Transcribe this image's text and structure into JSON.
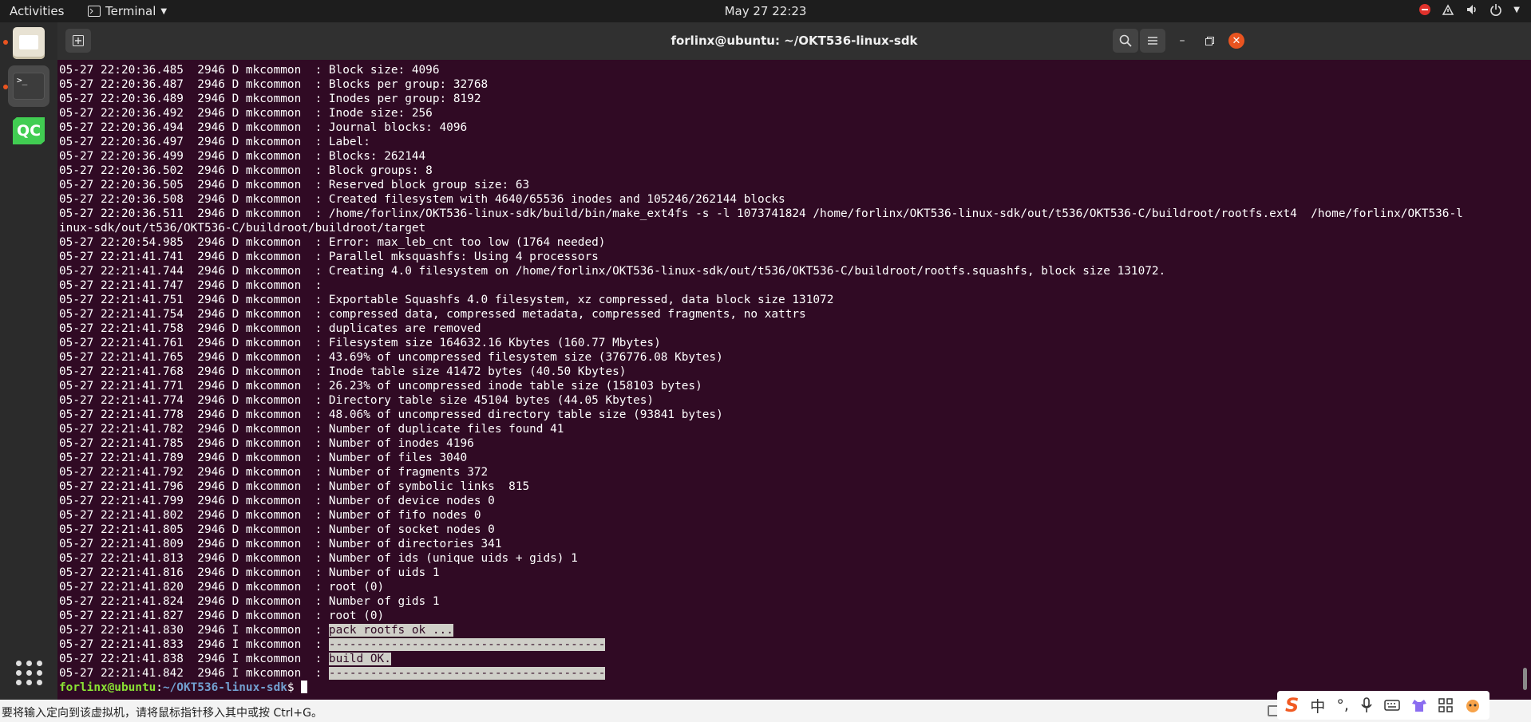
{
  "topbar": {
    "activities": "Activities",
    "app_menu": "Terminal",
    "clock": "May 27  22:23"
  },
  "window": {
    "title": "forlinx@ubuntu: ~/OKT536-linux-sdk"
  },
  "terminal": {
    "lines": [
      {
        "text": "05-27 22:20:36.485  2946 D mkcommon  : Block size: 4096"
      },
      {
        "text": "05-27 22:20:36.487  2946 D mkcommon  : Blocks per group: 32768"
      },
      {
        "text": "05-27 22:20:36.489  2946 D mkcommon  : Inodes per group: 8192"
      },
      {
        "text": "05-27 22:20:36.492  2946 D mkcommon  : Inode size: 256"
      },
      {
        "text": "05-27 22:20:36.494  2946 D mkcommon  : Journal blocks: 4096"
      },
      {
        "text": "05-27 22:20:36.497  2946 D mkcommon  : Label:"
      },
      {
        "text": "05-27 22:20:36.499  2946 D mkcommon  : Blocks: 262144"
      },
      {
        "text": "05-27 22:20:36.502  2946 D mkcommon  : Block groups: 8"
      },
      {
        "text": "05-27 22:20:36.505  2946 D mkcommon  : Reserved block group size: 63"
      },
      {
        "text": "05-27 22:20:36.508  2946 D mkcommon  : Created filesystem with 4640/65536 inodes and 105246/262144 blocks"
      },
      {
        "text": "05-27 22:20:36.511  2946 D mkcommon  : /home/forlinx/OKT536-linux-sdk/build/bin/make_ext4fs -s -l 1073741824 /home/forlinx/OKT536-linux-sdk/out/t536/OKT536-C/buildroot/rootfs.ext4  /home/forlinx/OKT536-l"
      },
      {
        "text": "inux-sdk/out/t536/OKT536-C/buildroot/buildroot/target"
      },
      {
        "text": "05-27 22:20:54.985  2946 D mkcommon  : Error: max_leb_cnt too low (1764 needed)"
      },
      {
        "text": "05-27 22:21:41.741  2946 D mkcommon  : Parallel mksquashfs: Using 4 processors"
      },
      {
        "text": "05-27 22:21:41.744  2946 D mkcommon  : Creating 4.0 filesystem on /home/forlinx/OKT536-linux-sdk/out/t536/OKT536-C/buildroot/rootfs.squashfs, block size 131072."
      },
      {
        "text": "05-27 22:21:41.747  2946 D mkcommon  :"
      },
      {
        "text": "05-27 22:21:41.751  2946 D mkcommon  : Exportable Squashfs 4.0 filesystem, xz compressed, data block size 131072"
      },
      {
        "text": "05-27 22:21:41.754  2946 D mkcommon  : compressed data, compressed metadata, compressed fragments, no xattrs"
      },
      {
        "text": "05-27 22:21:41.758  2946 D mkcommon  : duplicates are removed"
      },
      {
        "text": "05-27 22:21:41.761  2946 D mkcommon  : Filesystem size 164632.16 Kbytes (160.77 Mbytes)"
      },
      {
        "text": "05-27 22:21:41.765  2946 D mkcommon  : 43.69% of uncompressed filesystem size (376776.08 Kbytes)"
      },
      {
        "text": "05-27 22:21:41.768  2946 D mkcommon  : Inode table size 41472 bytes (40.50 Kbytes)"
      },
      {
        "text": "05-27 22:21:41.771  2946 D mkcommon  : 26.23% of uncompressed inode table size (158103 bytes)"
      },
      {
        "text": "05-27 22:21:41.774  2946 D mkcommon  : Directory table size 45104 bytes (44.05 Kbytes)"
      },
      {
        "text": "05-27 22:21:41.778  2946 D mkcommon  : 48.06% of uncompressed directory table size (93841 bytes)"
      },
      {
        "text": "05-27 22:21:41.782  2946 D mkcommon  : Number of duplicate files found 41"
      },
      {
        "text": "05-27 22:21:41.785  2946 D mkcommon  : Number of inodes 4196"
      },
      {
        "text": "05-27 22:21:41.789  2946 D mkcommon  : Number of files 3040"
      },
      {
        "text": "05-27 22:21:41.792  2946 D mkcommon  : Number of fragments 372"
      },
      {
        "text": "05-27 22:21:41.796  2946 D mkcommon  : Number of symbolic links  815"
      },
      {
        "text": "05-27 22:21:41.799  2946 D mkcommon  : Number of device nodes 0"
      },
      {
        "text": "05-27 22:21:41.802  2946 D mkcommon  : Number of fifo nodes 0"
      },
      {
        "text": "05-27 22:21:41.805  2946 D mkcommon  : Number of socket nodes 0"
      },
      {
        "text": "05-27 22:21:41.809  2946 D mkcommon  : Number of directories 341"
      },
      {
        "text": "05-27 22:21:41.813  2946 D mkcommon  : Number of ids (unique uids + gids) 1"
      },
      {
        "text": "05-27 22:21:41.816  2946 D mkcommon  : Number of uids 1"
      },
      {
        "text": "05-27 22:21:41.820  2946 D mkcommon  : root (0)"
      },
      {
        "text": "05-27 22:21:41.824  2946 D mkcommon  : Number of gids 1"
      },
      {
        "text": "05-27 22:21:41.827  2946 D mkcommon  : root (0)"
      },
      {
        "text": "05-27 22:21:41.830  2946 I mkcommon  : ",
        "hl": "pack rootfs ok ..."
      },
      {
        "text": "05-27 22:21:41.833  2946 I mkcommon  : ",
        "hl": "----------------------------------------"
      },
      {
        "text": "05-27 22:21:41.838  2946 I mkcommon  : ",
        "hl": "build OK."
      },
      {
        "text": "05-27 22:21:41.842  2946 I mkcommon  : ",
        "hl": "----------------------------------------"
      }
    ],
    "prompt_user": "forlinx@ubuntu",
    "prompt_sep": ":",
    "prompt_path": "~/OKT536-linux-sdk",
    "prompt_symbol": "$ "
  },
  "statusbar": {
    "message": "要将输入定向到该虚拟机，请将鼠标指针移入其中或按 Ctrl+G。"
  },
  "ime": {
    "logo": "S",
    "mode": "中",
    "punct": "°,"
  }
}
